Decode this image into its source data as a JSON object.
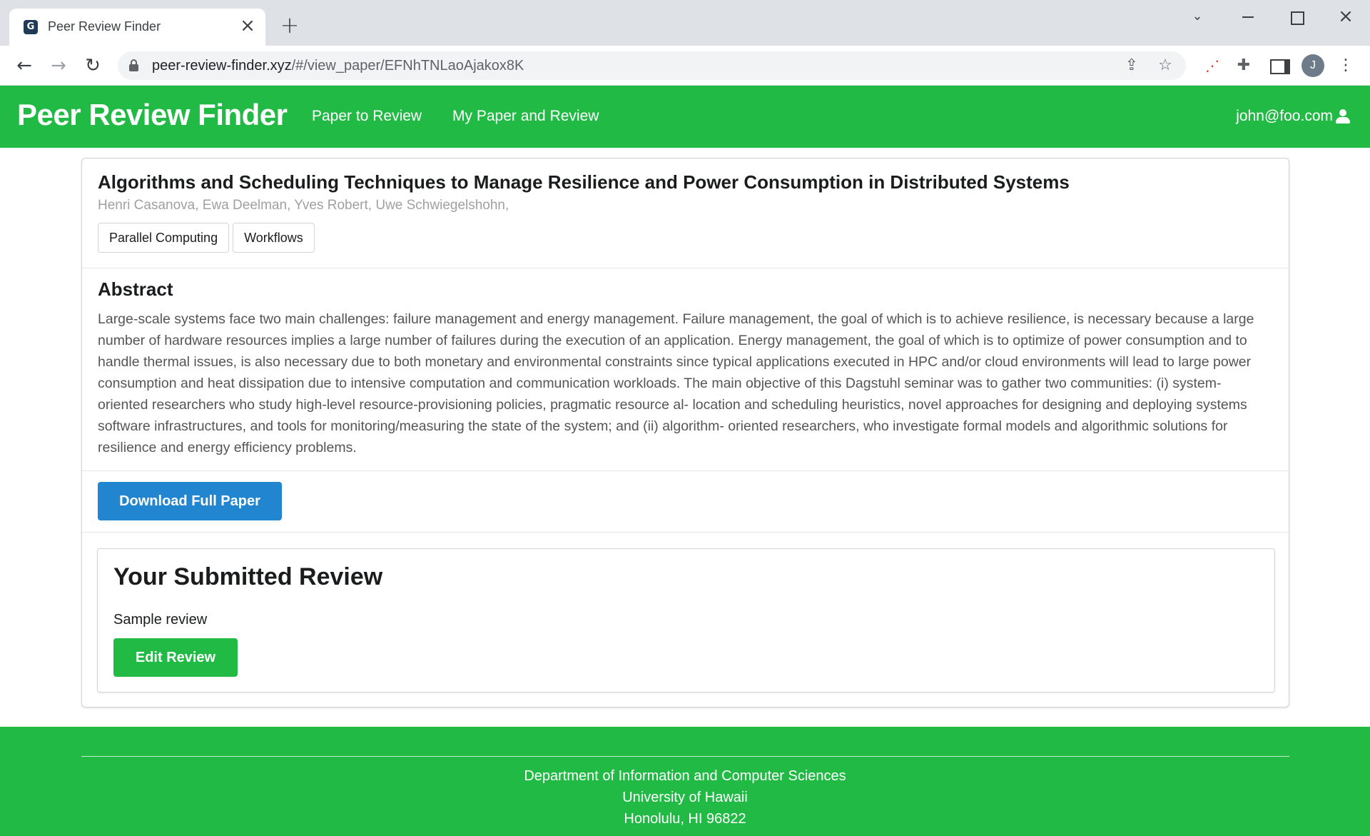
{
  "browser": {
    "tab_title": "Peer Review Finder",
    "favicon_glyph": "G",
    "url_host": "peer-review-finder.xyz",
    "url_path": "/#/view_paper/EFNhTNLaoAjakox8K",
    "profile_initial": "J",
    "icons": [
      "close-icon",
      "plus-icon",
      "back-arrow-icon",
      "forward-arrow-icon",
      "reload-icon",
      "lock-icon",
      "share-icon",
      "star-icon",
      "puzzle-icon",
      "side-panel-icon",
      "kebab-menu-icon"
    ]
  },
  "navbar": {
    "brand": "Peer Review Finder",
    "links": [
      "Paper to Review",
      "My Paper and Review"
    ],
    "user_email": "john@foo.com",
    "color": "#21ba45"
  },
  "paper": {
    "title": "Algorithms and Scheduling Techniques to Manage Resilience and Power Consumption in Distributed Systems",
    "authors": "Henri Casanova, Ewa Deelman, Yves Robert, Uwe Schwiegelshohn,",
    "tags": [
      "Parallel Computing",
      "Workflows"
    ],
    "abstract_heading": "Abstract",
    "abstract": "Large-scale systems face two main challenges: failure management and energy management. Failure management, the goal of which is to achieve resilience, is necessary because a large number of hardware resources implies a large number of failures during the execution of an application. Energy management, the goal of which is to optimize of power consumption and to handle thermal issues, is also necessary due to both monetary and environmental constraints since typical applications executed in HPC and/or cloud environments will lead to large power consumption and heat dissipation due to intensive computation and communication workloads. The main objective of this Dagstuhl seminar was to gather two communities: (i) system- oriented researchers who study high-level resource-provisioning policies, pragmatic resource al- location and scheduling heuristics, novel approaches for designing and deploying systems software infrastructures, and tools for monitoring/measuring the state of the system; and (ii) algorithm- oriented researchers, who investigate formal models and algorithmic solutions for resilience and energy efficiency problems.",
    "download_label": "Download Full Paper",
    "download_color": "#2185d0"
  },
  "review": {
    "heading": "Your Submitted Review",
    "text": "Sample review",
    "edit_label": "Edit Review"
  },
  "footer": {
    "lines": [
      "Department of Information and Computer Sciences",
      "University of Hawaii",
      "Honolulu, HI 96822"
    ]
  }
}
